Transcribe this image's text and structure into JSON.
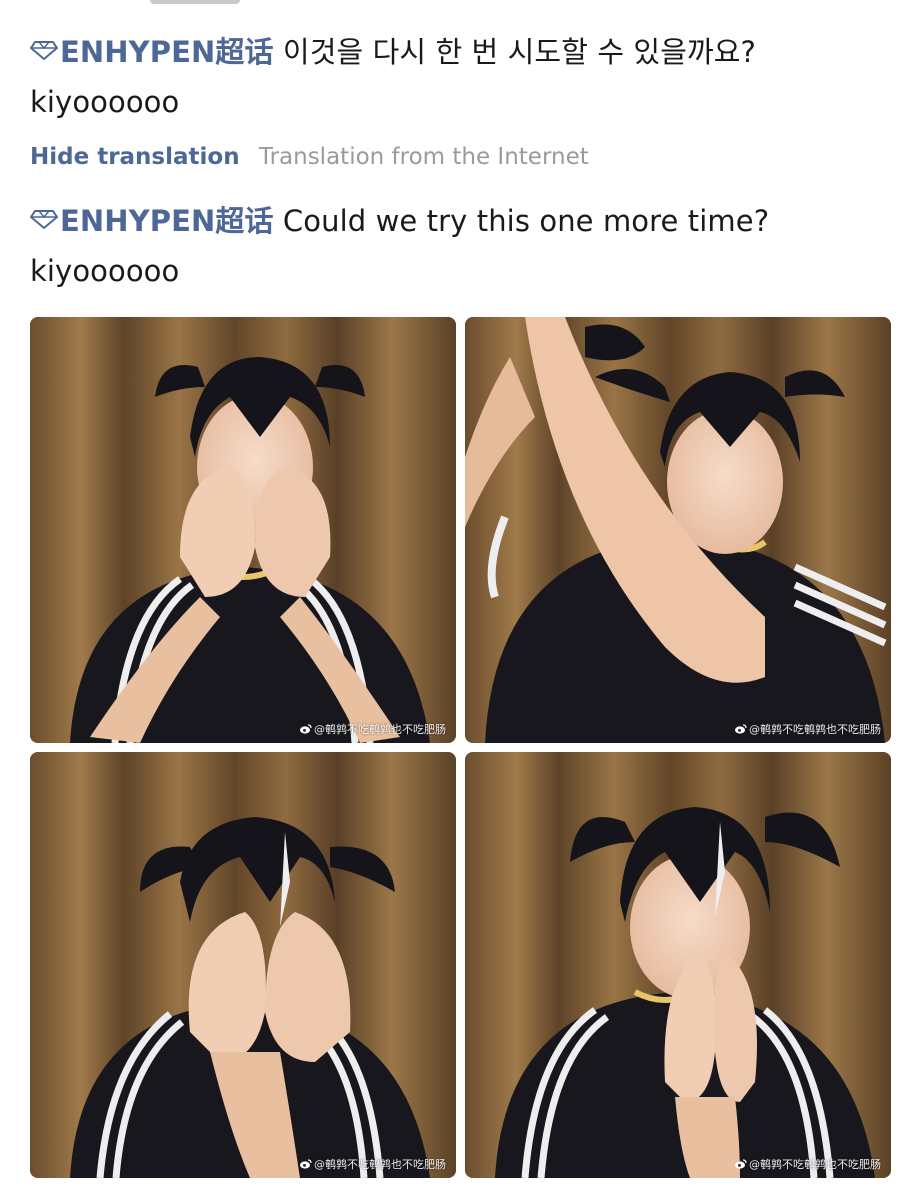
{
  "post": {
    "topic": "ENHYPEN超话",
    "original_text": "이것을 다시 한 번 시도할 수 있을까요?",
    "original_author_tag": "kiyoooooo",
    "translated_text": "Could we try this one more time?",
    "translated_author_tag": "kiyoooooo"
  },
  "translation": {
    "toggle_label": "Hide translation",
    "source_label": "Translation from the Internet"
  },
  "photos": [
    {
      "watermark": "@鹌鹑不吃鹌鹑也不吃肥肠",
      "subject": "person covering mouth with both hands, smiling"
    },
    {
      "watermark": "@鹌鹑不吃鹌鹑也不吃肥肠",
      "subject": "person with arm raised adjusting hair pigtails"
    },
    {
      "watermark": "@鹌鹑不吃鹌鹑也不吃肥肠",
      "subject": "person covering face with both hands"
    },
    {
      "watermark": "@鹌鹑不吃鹌鹑也不吃肥肠",
      "subject": "person hands pressed together over nose, laughing"
    }
  ],
  "colors": {
    "link": "#4d6797",
    "muted": "#9a9a9a",
    "text": "#1a1a1a"
  },
  "icons": {
    "topic": "diamond-icon",
    "watermark": "weibo-icon"
  }
}
